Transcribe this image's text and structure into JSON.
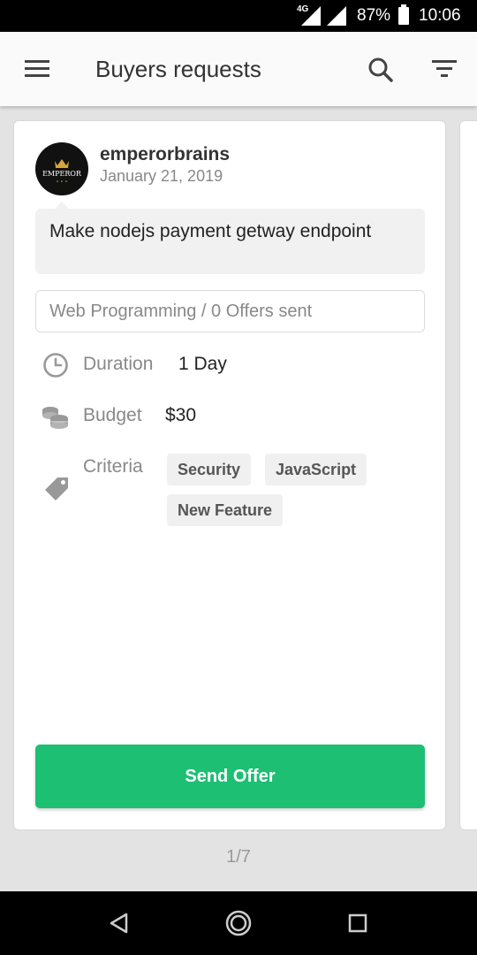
{
  "status_bar": {
    "network": "4G",
    "battery": "87%",
    "time": "10:06"
  },
  "app_bar": {
    "title": "Buyers requests",
    "icons": [
      "menu-icon",
      "search-icon",
      "filter-icon"
    ]
  },
  "request": {
    "username": "emperorbrains",
    "date": "January 21, 2019",
    "avatar_text": "EMPEROR",
    "title": "Make nodejs payment getway endpoint",
    "category": "Web Programming / 0 Offers sent",
    "duration_label": "Duration",
    "duration_value": "1 Day",
    "budget_label": "Budget",
    "budget_value": "$30",
    "criteria_label": "Criteria",
    "criteria": [
      "Security",
      "JavaScript",
      "New Feature"
    ],
    "send_offer_label": "Send Offer"
  },
  "pager": "1/7",
  "colors": {
    "accent": "#1dbf73",
    "app_bar": "#fafafa",
    "background": "#e3e3e3"
  }
}
